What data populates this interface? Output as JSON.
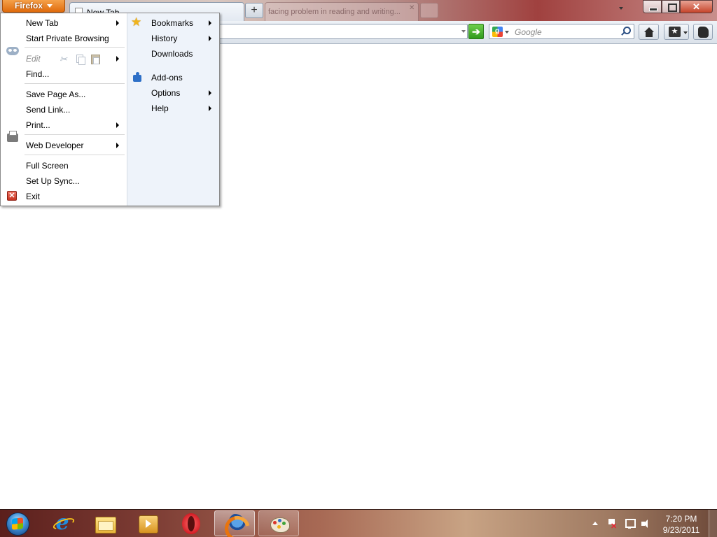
{
  "window": {
    "firefox_button_label": "Firefox",
    "tabs": [
      {
        "title": "New Tab",
        "active": true
      },
      {
        "title": "facing problem in reading and writing...",
        "active": false
      }
    ],
    "new_tab_symbol": "+",
    "close_symbol": "✕"
  },
  "navbar": {
    "url_value": "",
    "go_symbol": "➔",
    "search_placeholder": "Google",
    "search_engine_icon": "google-icon"
  },
  "app_menu": {
    "left_items": [
      {
        "label": "New Tab",
        "has_submenu": true
      },
      {
        "label": "Start Private Browsing",
        "icon": "private-browsing-mask-icon"
      },
      {
        "label": "Edit",
        "has_submenu": true,
        "disabled": true
      },
      {
        "label": "Find..."
      },
      {
        "label": "Save Page As..."
      },
      {
        "label": "Send Link..."
      },
      {
        "label": "Print...",
        "has_submenu": true,
        "icon": "printer-icon"
      },
      {
        "label": "Web Developer",
        "has_submenu": true
      },
      {
        "label": "Full Screen"
      },
      {
        "label": "Set Up Sync..."
      },
      {
        "label": "Exit",
        "icon": "exit-icon"
      }
    ],
    "right_items": [
      {
        "label": "Bookmarks",
        "has_submenu": true,
        "icon": "star-icon"
      },
      {
        "label": "History",
        "has_submenu": true
      },
      {
        "label": "Downloads"
      },
      {
        "label": "Add-ons",
        "icon": "puzzle-piece-icon"
      },
      {
        "label": "Options",
        "has_submenu": true
      },
      {
        "label": "Help",
        "has_submenu": true
      }
    ]
  },
  "taskbar": {
    "pinned": [
      "internet-explorer-icon",
      "windows-explorer-icon",
      "windows-media-player-icon",
      "opera-icon",
      "firefox-icon",
      "paint-icon"
    ],
    "active_app": "firefox-icon",
    "clock": {
      "time": "7:20 PM",
      "date": "9/23/2011"
    }
  },
  "colors": {
    "firefox_button": "#e06b0c",
    "menu_right_pane": "#eef3fa",
    "go_button": "#2f9a1c",
    "close_button": "#c6442a"
  }
}
